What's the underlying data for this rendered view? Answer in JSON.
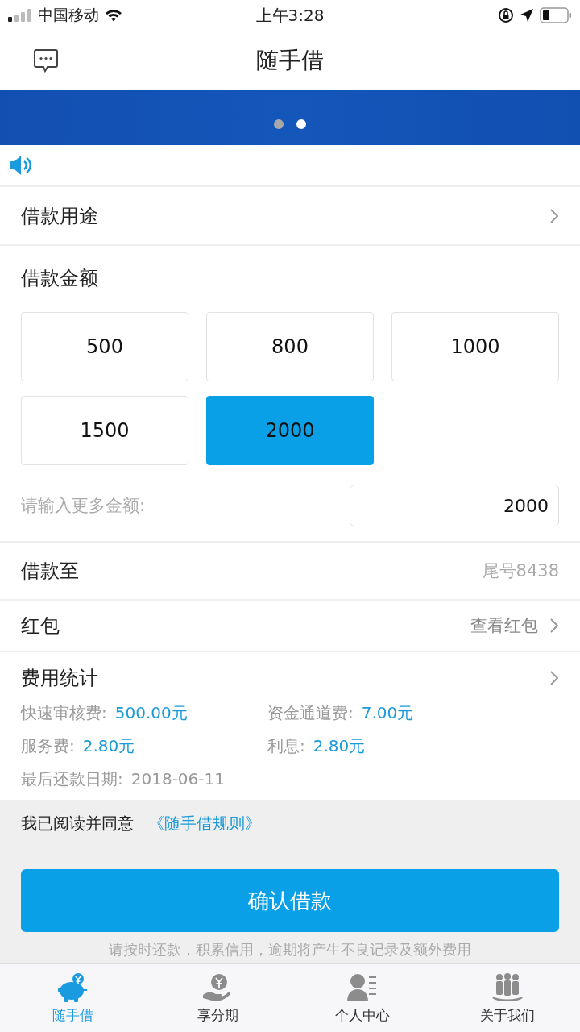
{
  "status_bar": {
    "carrier": "中国移动",
    "time": "上午3:28"
  },
  "nav": {
    "title": "随手借"
  },
  "banner": {
    "dots": [
      {
        "selected": false
      },
      {
        "selected": true
      }
    ]
  },
  "purpose": {
    "label": "借款用途"
  },
  "amount": {
    "label": "借款金额",
    "options": [
      {
        "label": "500",
        "selected": false
      },
      {
        "label": "800",
        "selected": false
      },
      {
        "label": "1000",
        "selected": false
      },
      {
        "label": "1500",
        "selected": false
      },
      {
        "label": "2000",
        "selected": true
      }
    ],
    "more": {
      "label": "请输入更多金额:",
      "value": "2000"
    }
  },
  "account": {
    "label": "借款至",
    "value": "尾号8438"
  },
  "red_packet": {
    "label": "红包",
    "link": "查看红包"
  },
  "fees": {
    "title": "费用统计",
    "items": [
      {
        "label": "快速审核费:",
        "value": "500.00元"
      },
      {
        "label": "资金通道费:",
        "value": "7.00元"
      },
      {
        "label": "服务费:",
        "value": "2.80元"
      },
      {
        "label": "利息:",
        "value": "2.80元"
      }
    ],
    "due": {
      "label": "最后还款日期:",
      "value": "2018-06-11"
    }
  },
  "agreement": {
    "text": "我已阅读并同意",
    "link": "《随手借规则》"
  },
  "confirm_button": "确认借款",
  "notice": "请按时还款，积累信用，逾期将产生不良记录及额外费用",
  "tabs": [
    {
      "kind": "piggy",
      "label": "随手借",
      "selected": true
    },
    {
      "kind": "hand",
      "label": "享分期",
      "selected": false
    },
    {
      "kind": "person",
      "label": "个人中心",
      "selected": false
    },
    {
      "kind": "group",
      "label": "关于我们",
      "selected": false
    }
  ]
}
